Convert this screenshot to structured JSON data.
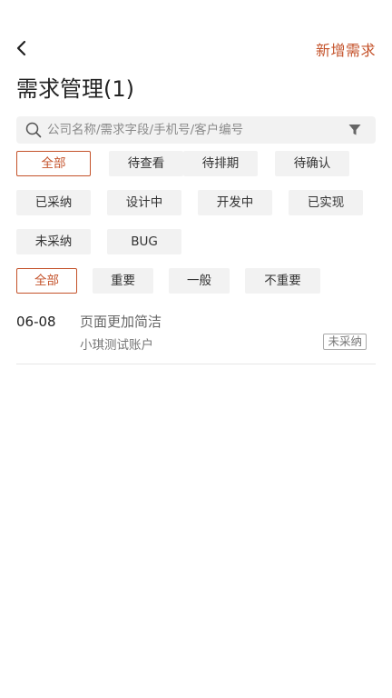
{
  "header": {
    "add_label": "新增需求",
    "title": "需求管理(1)"
  },
  "search": {
    "placeholder": "公司名称/需求字段/手机号/客户编号",
    "value": ""
  },
  "status_filters": [
    "全部",
    "待查看",
    "待排期",
    "待确认",
    "已采纳",
    "设计中",
    "开发中",
    "已实现",
    "未采纳",
    "BUG"
  ],
  "status_selected": "全部",
  "priority_filters": [
    "全部",
    "重要",
    "一般",
    "不重要"
  ],
  "priority_selected": "全部",
  "items": [
    {
      "date": "06-08",
      "title": "页面更加简洁",
      "account": "小琪测试账户",
      "status": "未采纳"
    }
  ],
  "colors": {
    "accent": "#c4522a",
    "chip_bg": "#f2f2f2",
    "divider": "#e6e6e6"
  }
}
